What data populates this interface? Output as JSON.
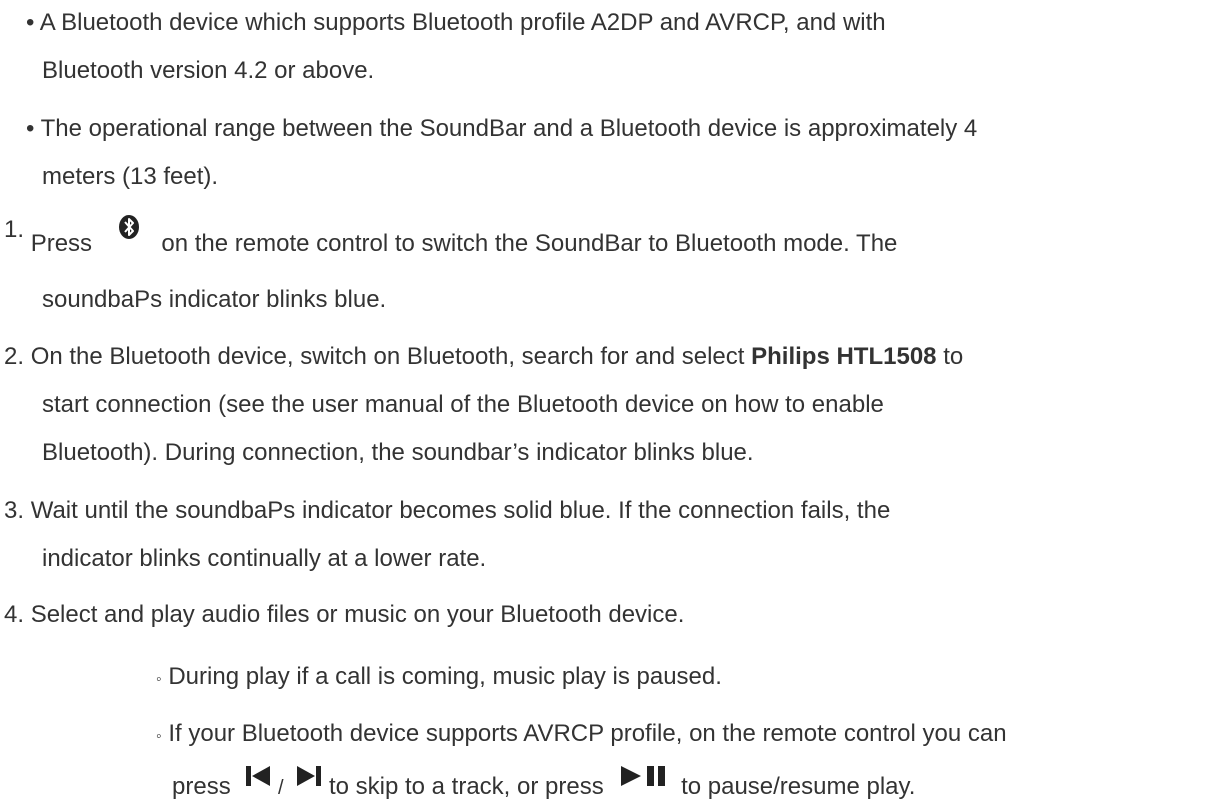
{
  "requirements": {
    "bullet": "•",
    "item1_line1": "A Bluetooth device which supports Bluetooth profile A2DP and AVRCP, and with",
    "item1_line2": "Bluetooth version 4.2 or above.",
    "item2_line1": "The operational range between the SoundBar and a Bluetooth device is approximately 4",
    "item2_line2": "meters (13 feet)."
  },
  "steps": {
    "step1": {
      "number": "1.",
      "before_icon": "Press",
      "icon": "bluetooth-icon",
      "after_icon": "on the remote control to switch the SoundBar to Bluetooth mode. The",
      "line2": "soundbaPs indicator blinks blue."
    },
    "step2": {
      "number": "2.",
      "line1_before": "On the Bluetooth device, switch on Bluetooth, search for and select",
      "device_name": "Philips HTL1508",
      "line1_after": "to",
      "line2": "start connection (see the user manual of the Bluetooth device on how to enable",
      "line3": "Bluetooth). During connection, the soundbar’s indicator blinks blue."
    },
    "step3": {
      "number": "3.",
      "line1": "Wait until the soundbaPs indicator becomes solid blue. If the connection fails, the",
      "line2": "indicator blinks continually at a lower rate."
    },
    "step4": {
      "number": "4.",
      "line1": "Select and play audio files or music on your Bluetooth device."
    }
  },
  "sub_notes": {
    "marker": "◦",
    "note1": "During play if a call is coming, music play is paused.",
    "note2_line1": "If your Bluetooth device supports AVRCP profile, on the remote control you can",
    "note2_press": "press",
    "prev_icon": "skip-previous-icon",
    "separator": "/",
    "next_icon": "skip-next-icon",
    "note2_mid": "to skip to a track, or press",
    "playpause_icon": "play-pause-icon",
    "note2_end": "to pause/resume play."
  }
}
